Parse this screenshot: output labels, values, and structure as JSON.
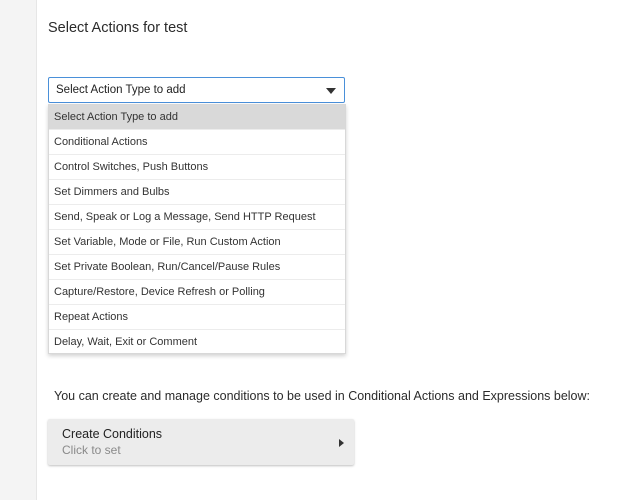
{
  "header": {
    "title": "Select Actions for test"
  },
  "action_select": {
    "value": "Select Action Type to add",
    "options": [
      "Select Action Type to add",
      "Conditional Actions",
      "Control Switches, Push Buttons",
      "Set Dimmers and Bulbs",
      "Send, Speak or Log a Message, Send HTTP Request",
      "Set Variable, Mode or File, Run Custom Action",
      "Set Private Boolean, Run/Cancel/Pause Rules",
      "Capture/Restore, Device Refresh or Polling",
      "Repeat Actions",
      "Delay, Wait, Exit or Comment"
    ],
    "selected_index": 0
  },
  "conditions": {
    "info_text": "You can create and manage conditions to be used in Conditional Actions and Expressions below:",
    "button_title": "Create Conditions",
    "button_subtitle": "Click to set"
  },
  "icons": {
    "select_caret": "caret-down-icon",
    "button_arrow": "triangle-right-icon"
  }
}
